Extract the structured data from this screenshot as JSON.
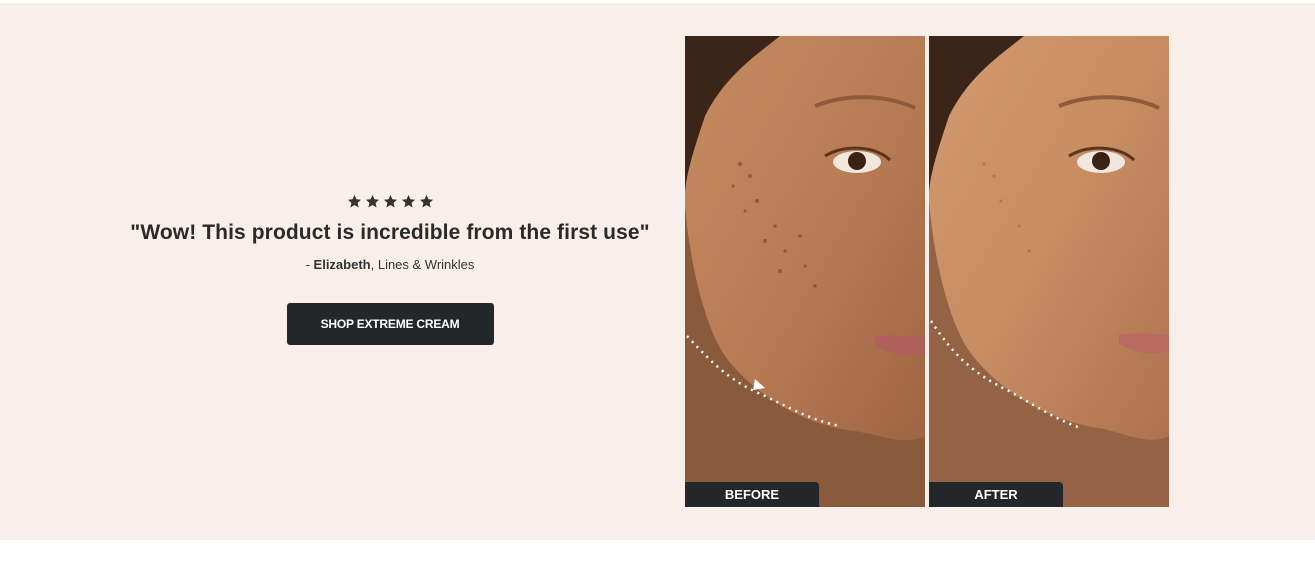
{
  "review": {
    "rating": 5,
    "rating_max": 5,
    "quote": "\"Wow! This product is incredible from the first use\"",
    "author_prefix": "- ",
    "author": "Elizabeth",
    "concern": ", Lines & Wrinkles"
  },
  "cta": {
    "label": "SHOP EXTREME CREAM"
  },
  "comparison": {
    "before_label": "BEFORE",
    "after_label": "AFTER"
  },
  "colors": {
    "section_bg": "#f9efea",
    "button_bg": "#24272a",
    "star": "#333333"
  },
  "icons": {
    "star": "star-icon",
    "arrow": "contour-arrow-icon"
  }
}
